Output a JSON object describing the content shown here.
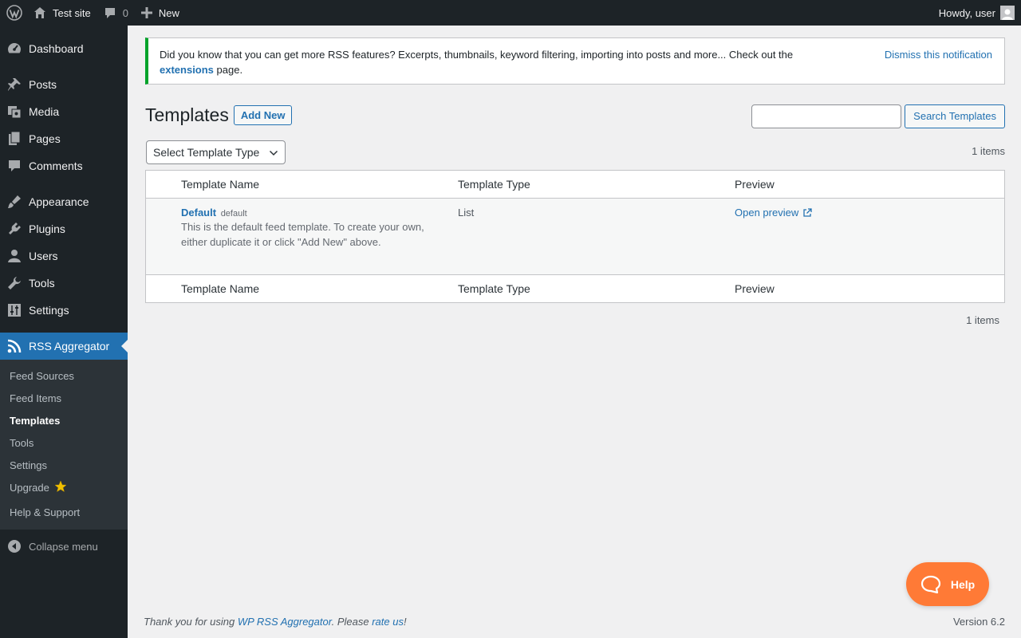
{
  "adminbar": {
    "site_name": "Test site",
    "comments_count": "0",
    "new_label": "New",
    "greeting": "Howdy, user"
  },
  "sidebar": {
    "items": [
      {
        "label": "Dashboard",
        "icon": "dashboard-icon"
      },
      {
        "label": "Posts",
        "icon": "pin-icon"
      },
      {
        "label": "Media",
        "icon": "media-icon"
      },
      {
        "label": "Pages",
        "icon": "pages-icon"
      },
      {
        "label": "Comments",
        "icon": "comment-icon"
      },
      {
        "label": "Appearance",
        "icon": "brush-icon"
      },
      {
        "label": "Plugins",
        "icon": "plug-icon"
      },
      {
        "label": "Users",
        "icon": "user-icon"
      },
      {
        "label": "Tools",
        "icon": "wrench-icon"
      },
      {
        "label": "Settings",
        "icon": "sliders-icon"
      },
      {
        "label": "RSS Aggregator",
        "icon": "rss-icon"
      }
    ],
    "submenu": [
      "Feed Sources",
      "Feed Items",
      "Templates",
      "Tools",
      "Settings",
      "Upgrade",
      "Help & Support"
    ],
    "collapse_label": "Collapse menu"
  },
  "notice": {
    "text": "Did you know that you can get more RSS features? Excerpts, thumbnails, keyword filtering, importing into posts and more... Check out the",
    "link": "extensions",
    "text_after": "page.",
    "dismiss": "Dismiss this notification"
  },
  "page": {
    "title": "Templates",
    "add_new": "Add New",
    "search_button": "Search Templates",
    "search_placeholder": "",
    "filter_value": "Select Template Type",
    "items_count": "1 items"
  },
  "table": {
    "columns": [
      "Template Name",
      "Template Type",
      "Preview"
    ],
    "rows": [
      {
        "name": "Default",
        "tag": "default",
        "description": "This is the default feed template. To create your own, either duplicate it or click \"Add New\" above.",
        "type": "List",
        "preview": "Open preview"
      }
    ]
  },
  "footer": {
    "thanks_prefix": "Thank you for using",
    "plugin_link": "WP RSS Aggregator",
    "middle": ". Please",
    "rate_link": "rate us",
    "suffix": "!",
    "version": "Version 6.2"
  },
  "help_button": "Help",
  "colors": {
    "accent": "#2271b1",
    "sidebar_bg": "#1d2327",
    "notice_border": "#00a32a",
    "help_orange": "#ff7a36",
    "star": "#f0c000"
  }
}
